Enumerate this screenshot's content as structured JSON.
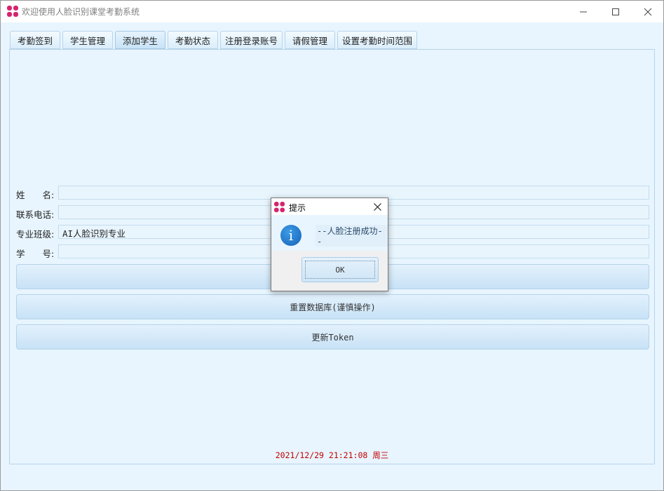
{
  "window": {
    "title": "欢迎使用人脸识别课堂考勤系统",
    "minimize_icon": "minimize-icon",
    "maximize_icon": "maximize-icon",
    "close_icon": "close-icon"
  },
  "tabs": [
    {
      "label": "考勤签到"
    },
    {
      "label": "学生管理"
    },
    {
      "label": "添加学生",
      "active": true
    },
    {
      "label": "考勤状态"
    },
    {
      "label": "注册登录账号"
    },
    {
      "label": "请假管理"
    },
    {
      "label": "设置考勤时间范围"
    }
  ],
  "form": {
    "name_label": "姓　　名:",
    "name_value": "",
    "phone_label": "联系电话:",
    "phone_value": "",
    "class_label": "专业班级:",
    "class_value": "AI人脸识别专业",
    "id_label": "学　　号:",
    "id_value": ""
  },
  "buttons": {
    "register": "",
    "reset_db": "重置数据库(谨慎操作)",
    "update_token": "更新Token"
  },
  "status": {
    "datetime": "2021/12/29 21:21:08 周三"
  },
  "dialog": {
    "title": "提示",
    "message": "--人脸注册成功--",
    "ok_label": "OK",
    "icon": "info-icon"
  },
  "colors": {
    "accent": "#c8e2f6",
    "status_text": "#c00000",
    "app_icon": "#d6246e"
  }
}
